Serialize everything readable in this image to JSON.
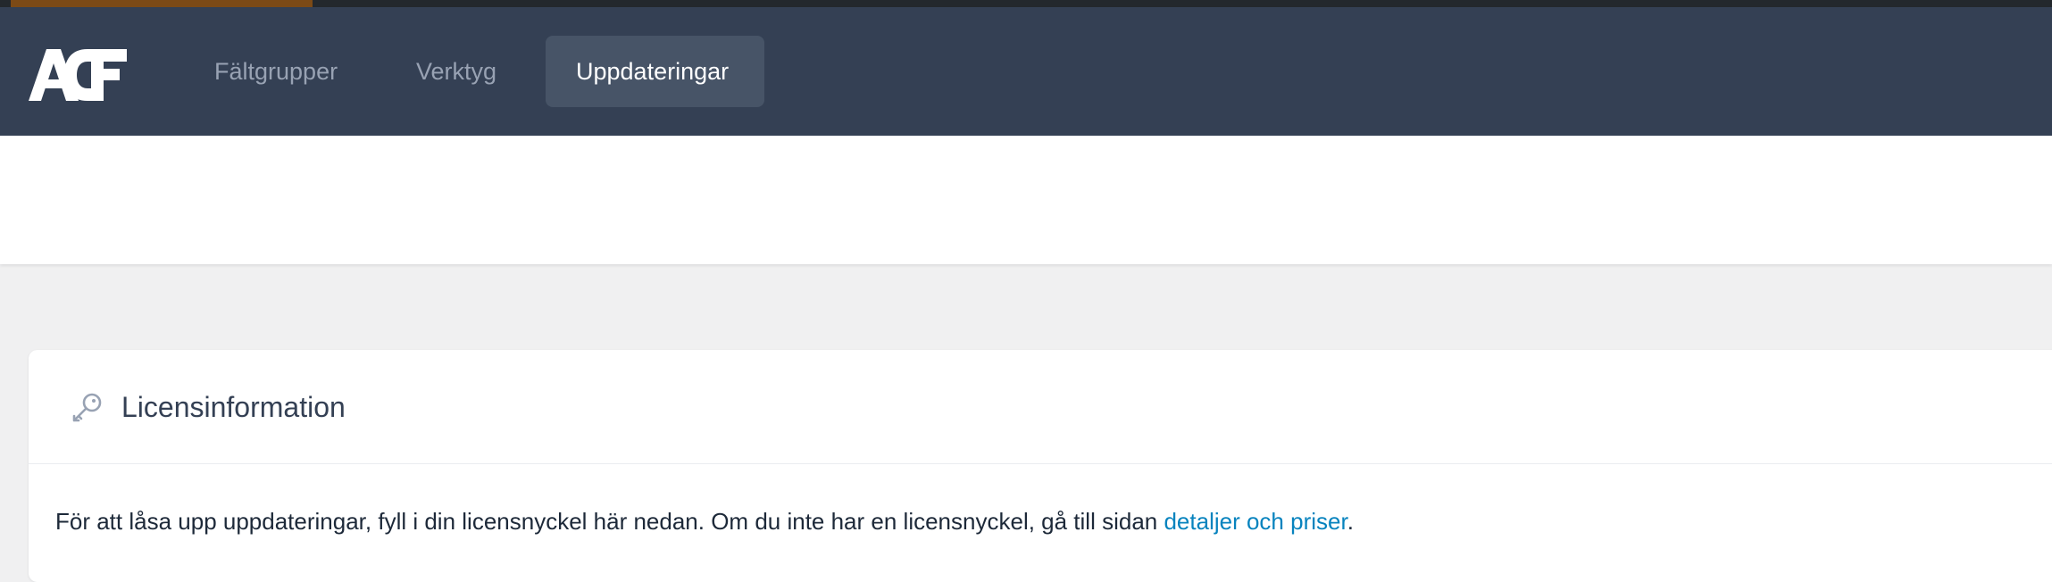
{
  "nav": {
    "logo_text": "ACF",
    "items": [
      {
        "label": "Fältgrupper",
        "active": false
      },
      {
        "label": "Verktyg",
        "active": false
      },
      {
        "label": "Uppdateringar",
        "active": true
      }
    ]
  },
  "license": {
    "icon": "key-icon",
    "title": "Licensinformation",
    "text_before": "För att låsa upp uppdateringar, fyll i din licensnyckel här nedan. Om du inte har en licensnyckel, gå till sidan ",
    "link_text": "detaljer och priser",
    "text_after": "."
  },
  "colors": {
    "nav_bg": "#344054",
    "nav_active_bg": "#475467",
    "nav_text": "#98a2b3",
    "link": "#0783be",
    "accent_strip": "#7c4a16"
  }
}
